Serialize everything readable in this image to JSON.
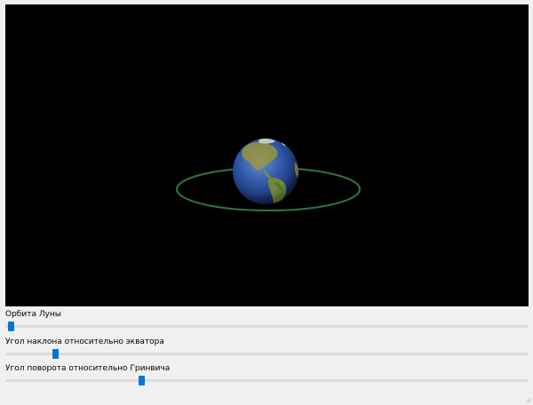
{
  "scene": {
    "background_color": "#000000",
    "orbit_color": "#2f7a45",
    "ocean_color": "#2a4f9e",
    "land_color": "#8a8f4a"
  },
  "controls": [
    {
      "label": "Орбита Луны",
      "value": 0.01
    },
    {
      "label": "Угол наклона относительно экватора",
      "value": 0.095
    },
    {
      "label": "Угол поворота относительно Гринвича",
      "value": 0.26
    }
  ],
  "accent_color": "#0078d7"
}
